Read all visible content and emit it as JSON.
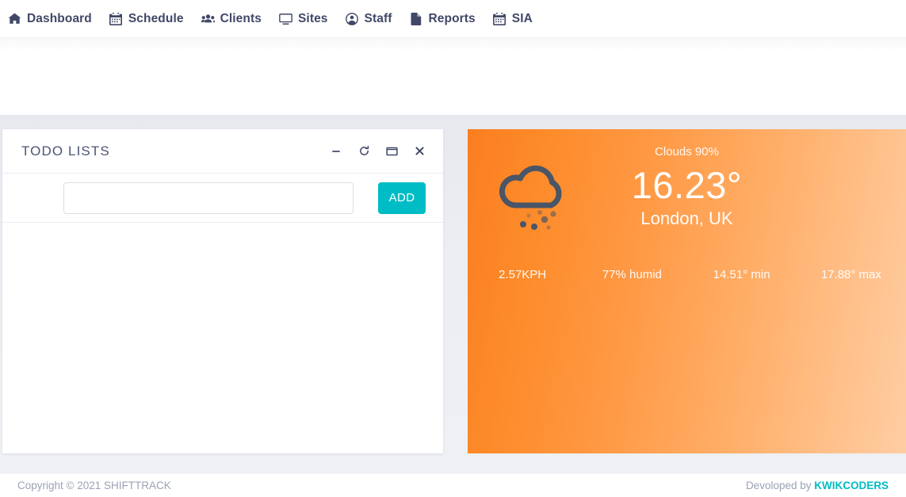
{
  "nav": {
    "items": [
      {
        "label": "Dashboard",
        "icon": "home-icon"
      },
      {
        "label": "Schedule",
        "icon": "calendar-icon"
      },
      {
        "label": "Clients",
        "icon": "users-icon"
      },
      {
        "label": "Sites",
        "icon": "desktop-icon"
      },
      {
        "label": "Staff",
        "icon": "user-circle-icon"
      },
      {
        "label": "Reports",
        "icon": "file-icon"
      },
      {
        "label": "SIA",
        "icon": "calendar-icon"
      }
    ]
  },
  "todo": {
    "title": "TODO LISTS",
    "tools": [
      {
        "name": "minimize-icon",
        "title": "Minimize"
      },
      {
        "name": "reload-icon",
        "title": "Reload"
      },
      {
        "name": "maximize-icon",
        "title": "Maximize"
      },
      {
        "name": "close-icon",
        "title": "Close"
      }
    ],
    "input_value": "",
    "input_placeholder": "",
    "add_label": "ADD",
    "items": []
  },
  "weather": {
    "condition": "Clouds 90%",
    "temperature": "16.23°",
    "location": "London, UK",
    "icon": "snow-cloud-icon",
    "stats": [
      {
        "name": "wind",
        "value": "2.57KPH"
      },
      {
        "name": "humidity",
        "value": "77% humid"
      },
      {
        "name": "temp-min",
        "value": "14.51° min"
      },
      {
        "name": "temp-max",
        "value": "17.88° max"
      }
    ]
  },
  "footer": {
    "copyright": "Copyright © 2021 SHIFTTRACK",
    "developed_by": "Devoloped by ",
    "developer": "KWIKCODERS"
  },
  "colors": {
    "accent_teal": "#00bcc4",
    "nav_text": "#414867",
    "weather_start": "#fb7e20",
    "weather_end": "#ffcda3",
    "muted_text": "#9aa2b5"
  }
}
